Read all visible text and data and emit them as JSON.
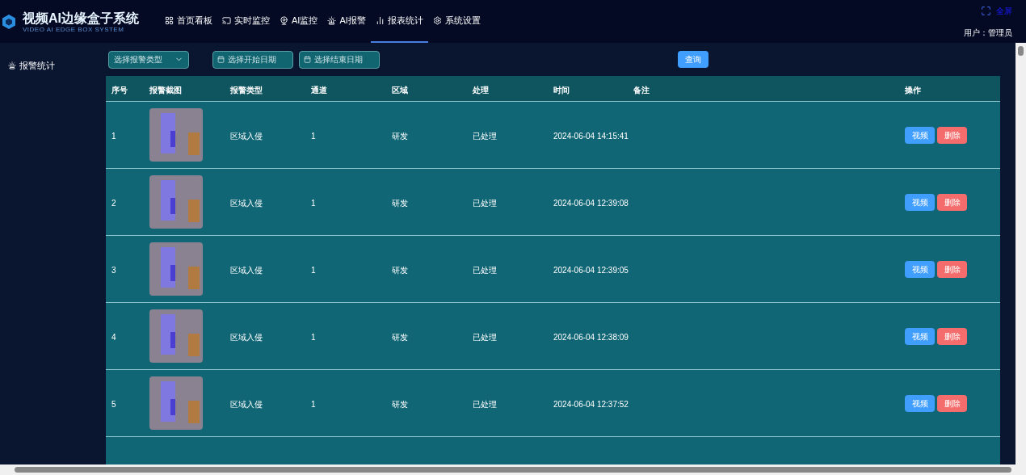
{
  "header": {
    "title": "视频AI边缘盒子系统",
    "subtitle": "VIDEO AI EDGE BOX SYSTEM",
    "nav": [
      {
        "label": "首页看板",
        "selected": false
      },
      {
        "label": "实时监控",
        "selected": false
      },
      {
        "label": "AI监控",
        "selected": false
      },
      {
        "label": "AI报警",
        "selected": false
      },
      {
        "label": "报表统计",
        "selected": true
      },
      {
        "label": "系统设置",
        "selected": false
      }
    ],
    "fullscreen": "全屏",
    "user": "用户：管理员"
  },
  "sidebar": {
    "items": [
      {
        "label": "报警统计",
        "selected": true
      }
    ]
  },
  "filters": {
    "alarm_type": {
      "placeholder": "选择报警类型"
    },
    "start_date": {
      "placeholder": "选择开始日期"
    },
    "end_date": {
      "placeholder": "选择结束日期"
    },
    "query_button": "查询"
  },
  "table": {
    "columns": [
      "序号",
      "报警截图",
      "报警类型",
      "通道",
      "区域",
      "处理",
      "时间",
      "备注",
      "操作"
    ],
    "rows": [
      {
        "index": "1",
        "type": "区域入侵",
        "channel": "1",
        "area": "研发",
        "status": "已处理",
        "time": "2024-06-04 14:15:41",
        "actions": [
          "视频",
          "删除"
        ]
      },
      {
        "index": "2",
        "type": "区域入侵",
        "channel": "1",
        "area": "研发",
        "status": "已处理",
        "time": "2024-06-04 12:39:08",
        "actions": [
          "视频",
          "删除"
        ]
      },
      {
        "index": "3",
        "type": "区域入侵",
        "channel": "1",
        "area": "研发",
        "status": "已处理",
        "time": "2024-06-04 12:39:05",
        "actions": [
          "视频",
          "删除"
        ]
      },
      {
        "index": "4",
        "type": "区域入侵",
        "channel": "1",
        "area": "研发",
        "status": "已处理",
        "time": "2024-06-04 12:38:09",
        "actions": [
          "视频",
          "删除"
        ]
      },
      {
        "index": "5",
        "type": "区域入侵",
        "channel": "1",
        "area": "研发",
        "status": "已处理",
        "time": "2024-06-04 12:37:52",
        "actions": [
          "视频",
          "删除"
        ]
      }
    ]
  }
}
